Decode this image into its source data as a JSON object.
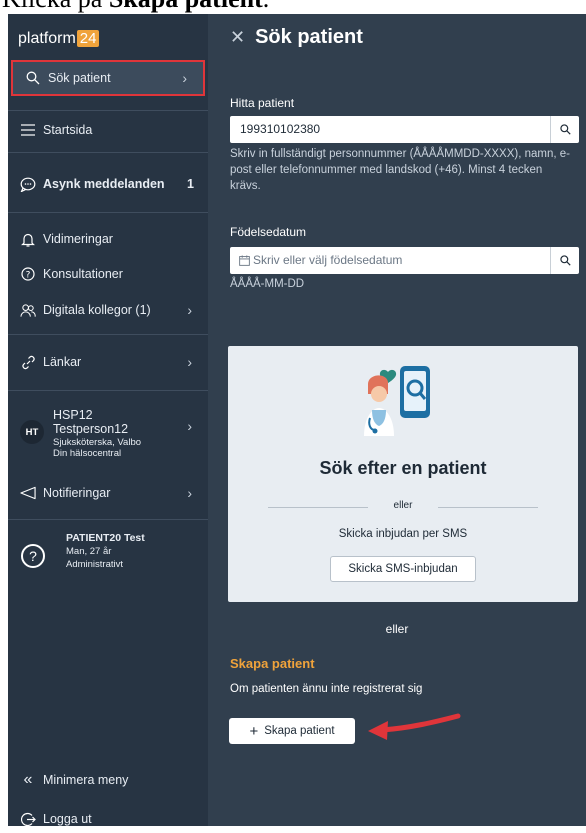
{
  "caption": {
    "prefix": "Klicka på ",
    "bold": "Skapa patient",
    "suffix": "."
  },
  "sidebar": {
    "logo_text": "platform",
    "logo_num": "24",
    "search_item": "Sök patient",
    "startsida": "Startsida",
    "async": "Asynk meddelanden",
    "async_count": "1",
    "vidimeringar": "Vidimeringar",
    "konsultationer": "Konsultationer",
    "kollegor": "Digitala kollegor (1)",
    "lankar": "Länkar",
    "user": {
      "initials": "HT",
      "line1": "HSP12",
      "line2": "Testperson12",
      "line3": "Sjuksköterska, Valbo",
      "line4": "Din hälsocentral"
    },
    "notifieringar": "Notifieringar",
    "patient": {
      "name": "PATIENT20 Test",
      "age": "Man, 27 år",
      "status": "Administrativt"
    },
    "minimize": "Minimera meny",
    "logout": "Logga ut"
  },
  "main": {
    "title": "Sök patient",
    "find_label": "Hitta patient",
    "find_value": "199310102380",
    "find_help": "Skriv in fullständigt personnummer (ÅÅÅÅMMDD-XXXX), namn, e-post eller telefonnummer med landskod (+46). Minst 4 tecken krävs.",
    "dob_label": "Födelsedatum",
    "dob_placeholder": "Skriv eller välj födelsedatum",
    "dob_format": "ÅÅÅÅ-MM-DD",
    "card": {
      "title": "Sök efter en patient",
      "or": "eller",
      "sms_text": "Skicka inbjudan per SMS",
      "sms_button": "Skicka SMS-inbjudan"
    },
    "or": "eller",
    "create_title": "Skapa patient",
    "create_sub": "Om patienten ännu inte registrerat sig",
    "create_button": "Skapa patient"
  },
  "colors": {
    "sidebar_bg": "#273443",
    "main_bg": "#313f4e",
    "accent_orange": "#f0a33b",
    "highlight_red": "#e0353a",
    "card_bg": "#e8edf2"
  }
}
